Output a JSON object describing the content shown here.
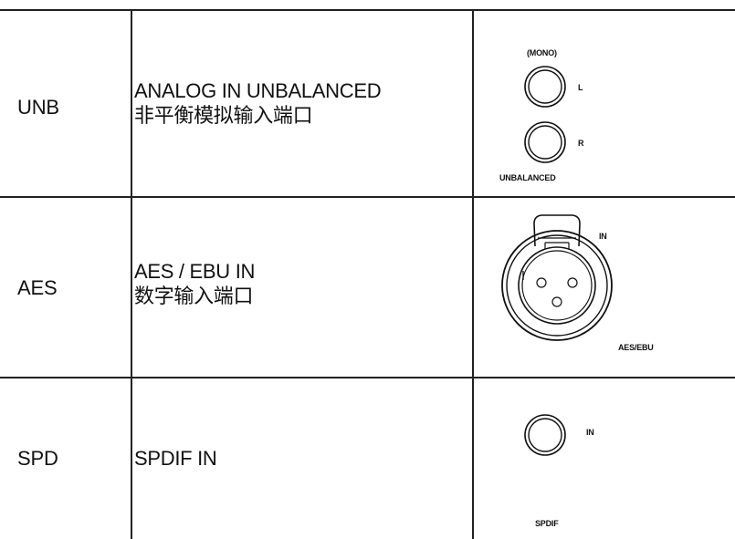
{
  "rows": [
    {
      "code": "UNB",
      "description_lines": [
        "ANALOG IN UNBALANCED",
        "非平衡模拟输入端口"
      ],
      "connector": {
        "icon": "rca-jack-pair-icon",
        "top_label": "(MONO)",
        "jack_labels": [
          "L",
          "R"
        ],
        "bottom_label": "UNBALANCED"
      }
    },
    {
      "code": "AES",
      "description_lines": [
        "AES / EBU IN",
        "数字输入端口"
      ],
      "connector": {
        "icon": "xlr-female-connector-icon",
        "side_label": "IN",
        "bottom_label": "AES/EBU"
      }
    },
    {
      "code": "SPD",
      "description_lines": [
        "SPDIF IN"
      ],
      "connector": {
        "icon": "rca-jack-icon",
        "side_label": "IN",
        "bottom_label": "SPDIF"
      }
    }
  ]
}
